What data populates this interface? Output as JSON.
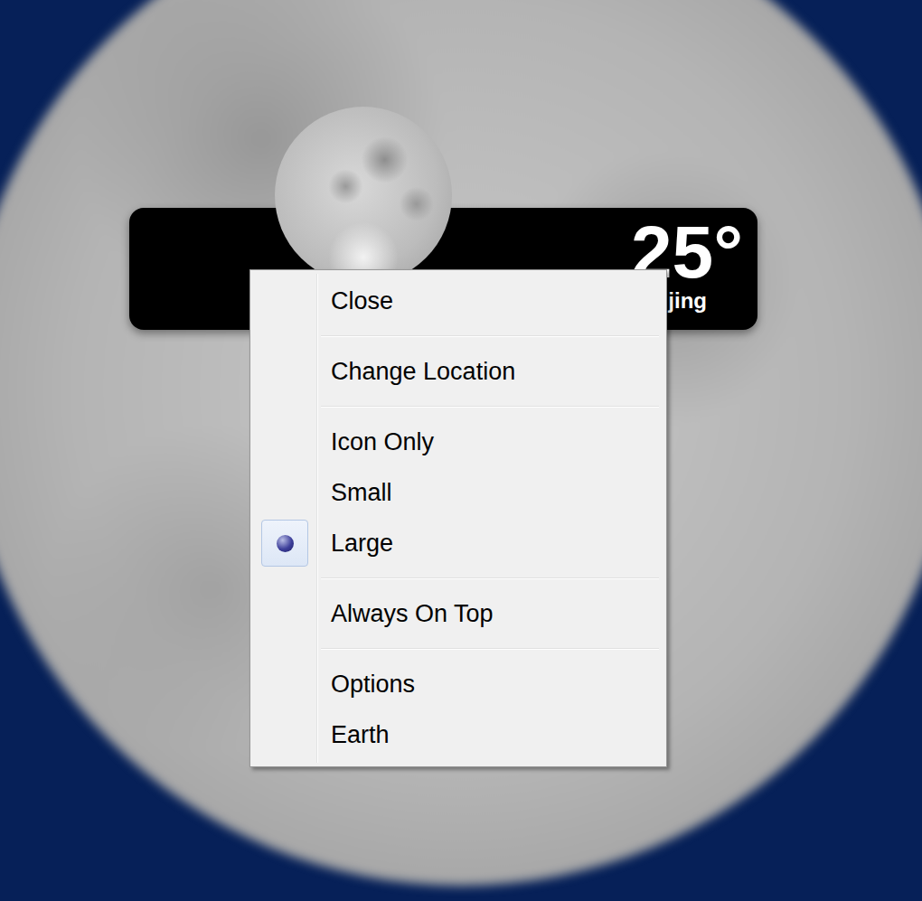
{
  "gadget": {
    "temperature": "25°",
    "location": "jing"
  },
  "menu": {
    "groups": [
      [
        {
          "label": "Close",
          "selected": false
        }
      ],
      [
        {
          "label": "Change Location",
          "selected": false
        }
      ],
      [
        {
          "label": "Icon Only",
          "selected": false
        },
        {
          "label": "Small",
          "selected": false
        },
        {
          "label": "Large",
          "selected": true
        }
      ],
      [
        {
          "label": "Always On Top",
          "selected": false
        }
      ],
      [
        {
          "label": "Options",
          "selected": false
        },
        {
          "label": "Earth",
          "selected": false
        }
      ]
    ]
  }
}
